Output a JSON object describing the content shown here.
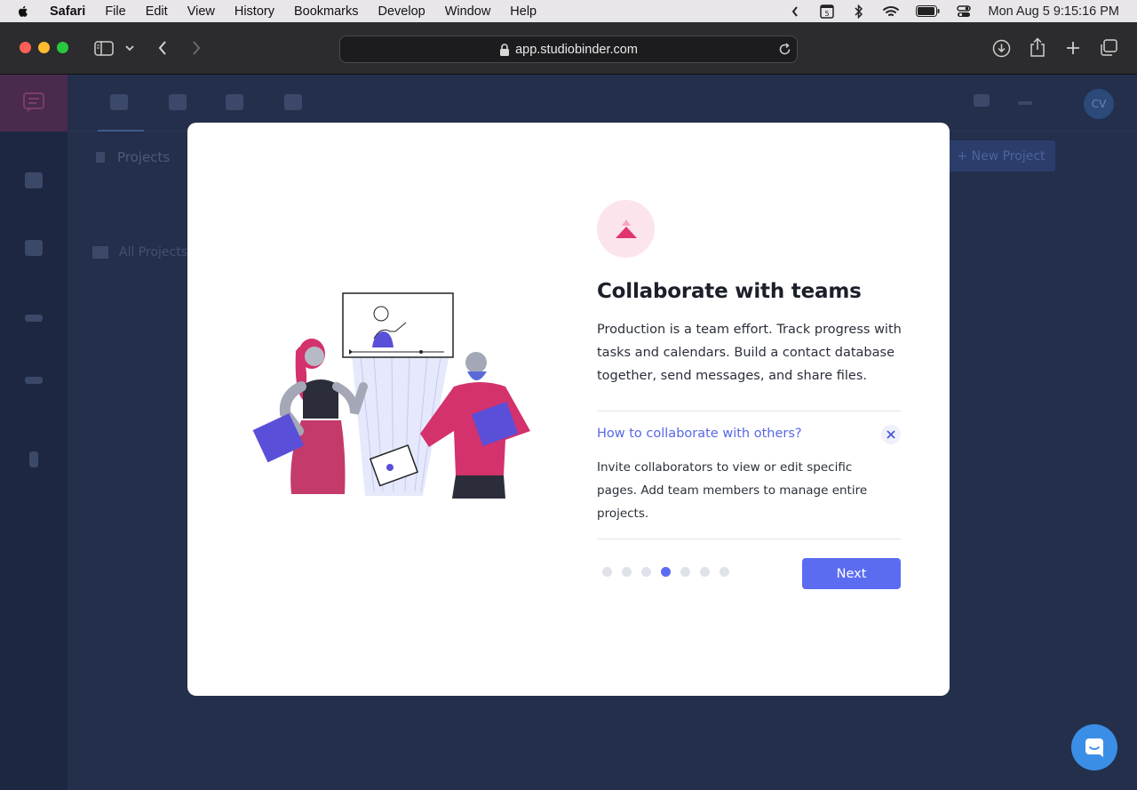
{
  "menubar": {
    "app": "Safari",
    "items": [
      "File",
      "Edit",
      "View",
      "History",
      "Bookmarks",
      "Develop",
      "Window",
      "Help"
    ],
    "calendar_badge": "5",
    "datetime": "Mon Aug 5  9:15:16 PM"
  },
  "browser": {
    "url": "app.studiobinder.com"
  },
  "app_bg": {
    "projects_label": "Projects",
    "new_project_label": "+ New Project",
    "all_projects_label": "All Projects",
    "avatar_initials": "CV"
  },
  "modal": {
    "title": "Collaborate with teams",
    "description": "Production is a team effort. Track progress with tasks and calendars. Build a contact database together, send messages, and share files.",
    "question": "How to collaborate with others?",
    "answer": "Invite collaborators to view or edit specific pages. Add team members to manage entire projects.",
    "next_label": "Next",
    "steps_total": 7,
    "step_current": 4
  },
  "colors": {
    "accent": "#5c6cf1",
    "pink": "#e0356f",
    "badge_bg": "#fce4ec"
  }
}
